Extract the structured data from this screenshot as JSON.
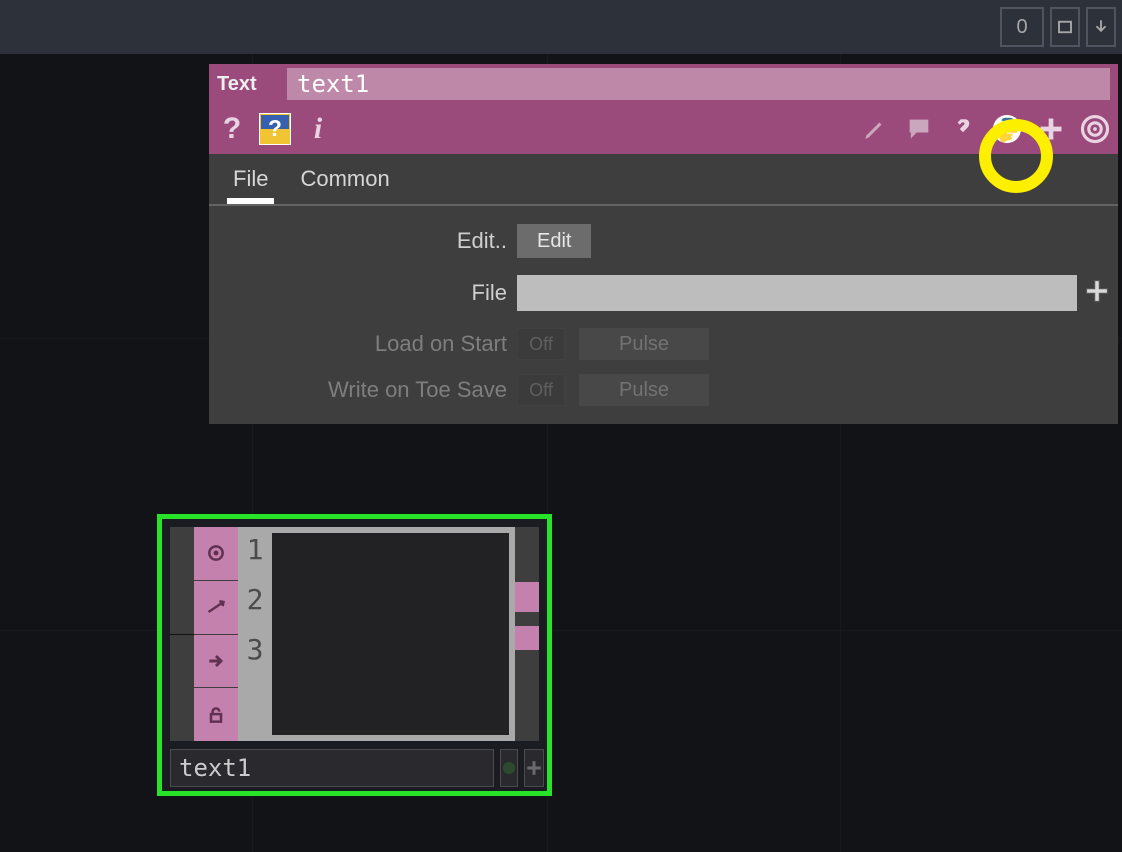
{
  "topbar": {
    "count": "0"
  },
  "panel": {
    "type": "Text",
    "name": "text1",
    "tabs": [
      "File",
      "Common"
    ],
    "active_tab": "File",
    "params": {
      "edit_label": "Edit..",
      "edit_button": "Edit",
      "file_label": "File",
      "file_value": "",
      "load_label": "Load on Start",
      "load_value": "Off",
      "write_label": "Write on Toe Save",
      "write_value": "Off",
      "pulse_label": "Pulse"
    }
  },
  "node": {
    "name": "text1",
    "lines": [
      "1",
      "2",
      "3"
    ]
  }
}
